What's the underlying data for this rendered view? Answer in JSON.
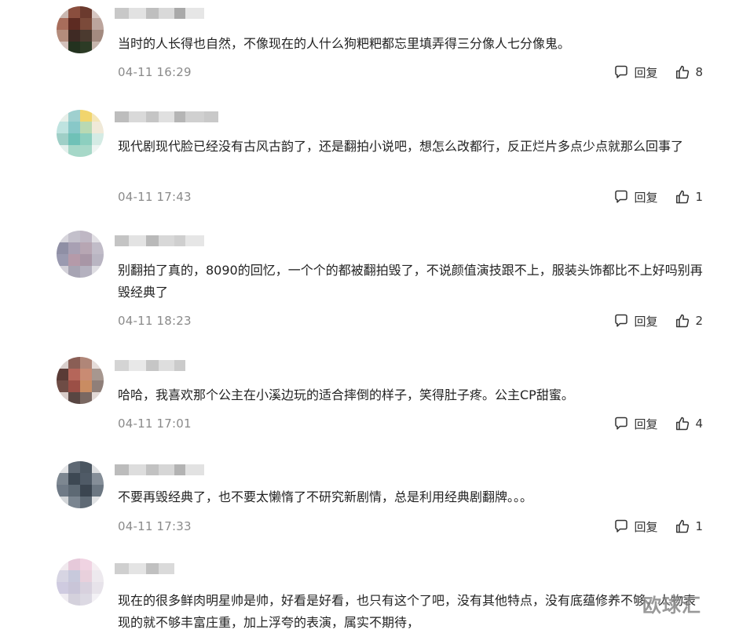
{
  "comments": [
    {
      "text": "当时的人长得也自然，不像现在的人什么狗粑粑都忘里填弄得三分像人七分像鬼。",
      "time": "04-11 16:29",
      "reply_label": "回复",
      "likes": "8",
      "avatar_colors": [
        "#c9b7b0",
        "#8a4e3e",
        "#6b3a2e",
        "#d7c7c2",
        "#a86d5b",
        "#5d2b22",
        "#7b4a3a",
        "#bca59d",
        "#b48c7c",
        "#3f2a24",
        "#4b3a2f",
        "#a38a7f",
        "#d3c1bb",
        "#23321f",
        "#2c3b25",
        "#c7b6ad"
      ],
      "name_colors": [
        "#c8c8c8",
        "#e2e2e2",
        "#bfbfbf",
        "#d9d9d9",
        "#a9a9a9",
        "#e6e6e6"
      ]
    },
    {
      "text": "现代剧现代脸已经没有古风古韵了，还是翻拍小说吧，想怎么改都行，反正烂片多点少点就那么回事了",
      "time": "04-11 17:43",
      "reply_label": "回复",
      "likes": "1",
      "avatar_colors": [
        "#e7efe9",
        "#9fd0cf",
        "#f1d56d",
        "#f4e6b8",
        "#bfe3e0",
        "#88c8c8",
        "#b9d9b3",
        "#f0e9d8",
        "#9fcfc7",
        "#6fc1b7",
        "#8dcfbf",
        "#d4ebe4",
        "#e3f0ec",
        "#a5d7c8",
        "#a7d8c8",
        "#eef5f2"
      ],
      "name_colors": [
        "#bdbdbd",
        "#d9d9d9",
        "#c5c5c5",
        "#e0e0e0",
        "#b5b5b5",
        "#d0d0d0",
        "#c9c9c9"
      ]
    },
    {
      "text": "别翻拍了真的，8090的回忆，一个个的都被翻拍毁了，不说颜值演技跟不上，服装头饰都比不上好吗别再毁经典了",
      "time": "04-11 18:23",
      "reply_label": "回复",
      "likes": "2",
      "avatar_colors": [
        "#d7d5dc",
        "#c3c0cb",
        "#bfb7c4",
        "#e1dfe4",
        "#8f8fa5",
        "#a8a0b3",
        "#b7a6b3",
        "#c1bcc8",
        "#9a9ab0",
        "#b59aa9",
        "#a896a6",
        "#b9b5c2",
        "#d2d0d8",
        "#a7a4b3",
        "#b4b1bf",
        "#dedde2"
      ],
      "name_colors": [
        "#c4c4c4",
        "#e3e3e3",
        "#b9b9b9",
        "#d8d8d8",
        "#cfcfcf",
        "#e6e6e6"
      ]
    },
    {
      "text": "哈哈，我喜欢那个公主在小溪边玩的适合摔倒的样子，笑得肚子疼。公主CP甜蜜。",
      "time": "04-11 17:01",
      "reply_label": "回复",
      "likes": "4",
      "avatar_colors": [
        "#d9cfcc",
        "#8a5e55",
        "#b08678",
        "#e5dcd9",
        "#5a3b36",
        "#b5665a",
        "#c98b73",
        "#a7978f",
        "#6e4c45",
        "#9b4f46",
        "#c98c62",
        "#8f7f79",
        "#d8ccc8",
        "#584642",
        "#7a6862",
        "#e2d9d6"
      ],
      "name_colors": [
        "#d4d4d4",
        "#e8e8e8",
        "#c6c6c6",
        "#dedede",
        "#cbcbcb"
      ]
    },
    {
      "text": "不要再毁经典了，也不要太懒惰了不研究新剧情，总是利用经典剧翻牌。。。",
      "time": "04-11 17:33",
      "reply_label": "回复",
      "likes": "1",
      "avatar_colors": [
        "#e3e4e6",
        "#5e6873",
        "#4b5661",
        "#dcdee0",
        "#7d8791",
        "#3d4853",
        "#4f5a66",
        "#858e98",
        "#6f7a86",
        "#5d6974",
        "#3b4550",
        "#6c7782",
        "#d2d5d8",
        "#7a8590",
        "#5f6a75",
        "#e0e2e4"
      ],
      "name_colors": [
        "#bcbcbc",
        "#dddddd",
        "#c2c2c2",
        "#d6d6d6",
        "#b3b3b3",
        "#e2e2e2"
      ]
    },
    {
      "text": "现在的很多鲜肉明星帅是帅，好看是好看，也只有这个了吧，没有其他特点，没有底蕴修养不够，人物表现的就不够丰富庄重，加上浮夸的表演，属实不期待，",
      "time": "",
      "reply_label": "",
      "likes": "",
      "avatar_colors": [
        "#f0e9ee",
        "#e6c9da",
        "#f0d3e2",
        "#f5eef2",
        "#d7d5e3",
        "#c8c9dc",
        "#e8d0dc",
        "#ede9ee",
        "#cfcbe0",
        "#c9c5d8",
        "#d8d1de",
        "#e7e3ea",
        "#efecf1",
        "#d4d1dc",
        "#dcd9e3",
        "#f3f1f5"
      ],
      "name_colors": [
        "#cfcfcf",
        "#e4e4e4",
        "#c0c0c0",
        "#dadada"
      ]
    }
  ],
  "watermark": "欧球汇"
}
